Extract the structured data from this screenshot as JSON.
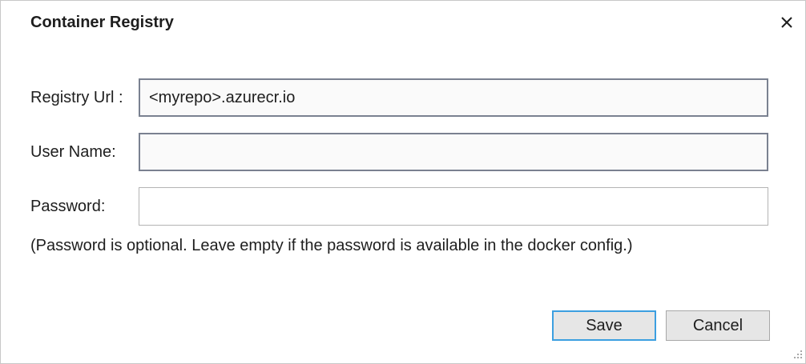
{
  "dialog": {
    "title": "Container Registry",
    "close_icon": "close-icon"
  },
  "form": {
    "registry_url": {
      "label": "Registry Url :",
      "value": "<myrepo>.azurecr.io"
    },
    "user_name": {
      "label": "User Name:",
      "value": ""
    },
    "password": {
      "label": "Password:",
      "value": ""
    },
    "note": "(Password is optional. Leave empty if the password is available in the docker config.)"
  },
  "buttons": {
    "save_label": "Save",
    "cancel_label": "Cancel"
  },
  "colors": {
    "primary_focus_border": "#3c9fe0",
    "input_border": "#7a8190",
    "button_bg": "#e6e6e6"
  }
}
